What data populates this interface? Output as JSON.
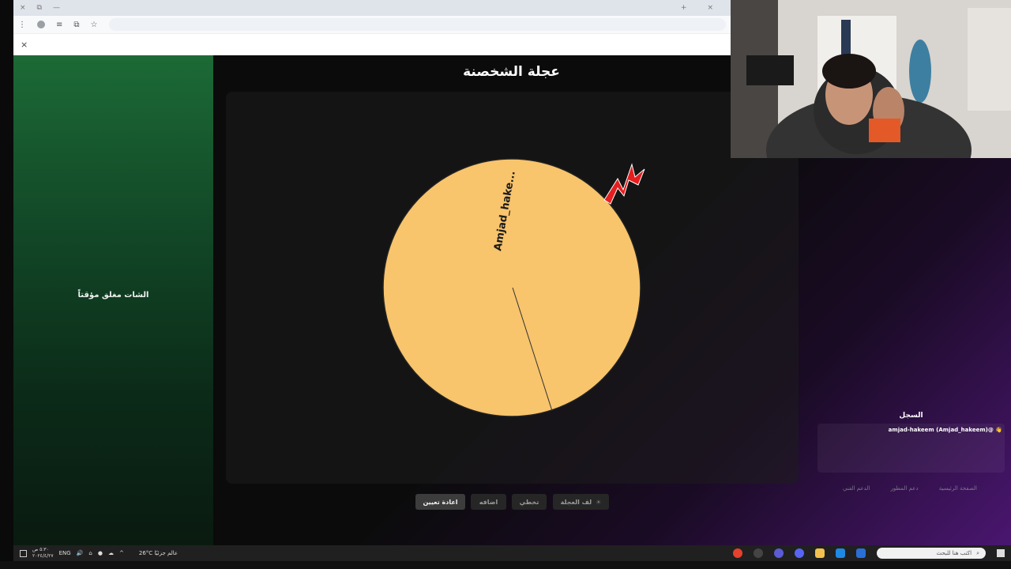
{
  "browser": {
    "tab_strip_icons": [
      "×",
      "⧉",
      "—"
    ],
    "window_controls": [
      "+",
      "×"
    ],
    "toolbar_icons": [
      "⋮",
      "≡",
      "⧉",
      "☆"
    ],
    "infobar_close": "×"
  },
  "app": {
    "title": "عجلة الشخصنة",
    "chat_closed_label": "الشات مغلق مؤقتاً",
    "wheel": {
      "segment_label": "Amjad_hake...",
      "segment_color": "#F8C46C",
      "pointer_color": "#E51E1E"
    },
    "buttons": {
      "reset": "اعادة تعيين",
      "add": "اضافه",
      "skip": "تخطي",
      "spin": "لف العجلة",
      "spin_icon": "☀"
    },
    "log": {
      "title": "السجل",
      "entries": [
        "amjad-hakeem (Amjad_hakeem)@ 👋"
      ]
    },
    "footer_links": [
      "الدعم الفني",
      "دعم المطور",
      "الصفحة الرئيسية"
    ]
  },
  "taskbar": {
    "time": "٥:٣٠ ص",
    "date": "٢٠٢٤/٤/٢٧",
    "language": "ENG",
    "weather": "26°C عالم جزئيًا",
    "search_placeholder": "اكتب هنا للبحث",
    "colors": {
      "chrome": "#E5412E",
      "edge": "#1E88E5",
      "files": "#F2C14E",
      "store": "#2A6FD6"
    }
  }
}
